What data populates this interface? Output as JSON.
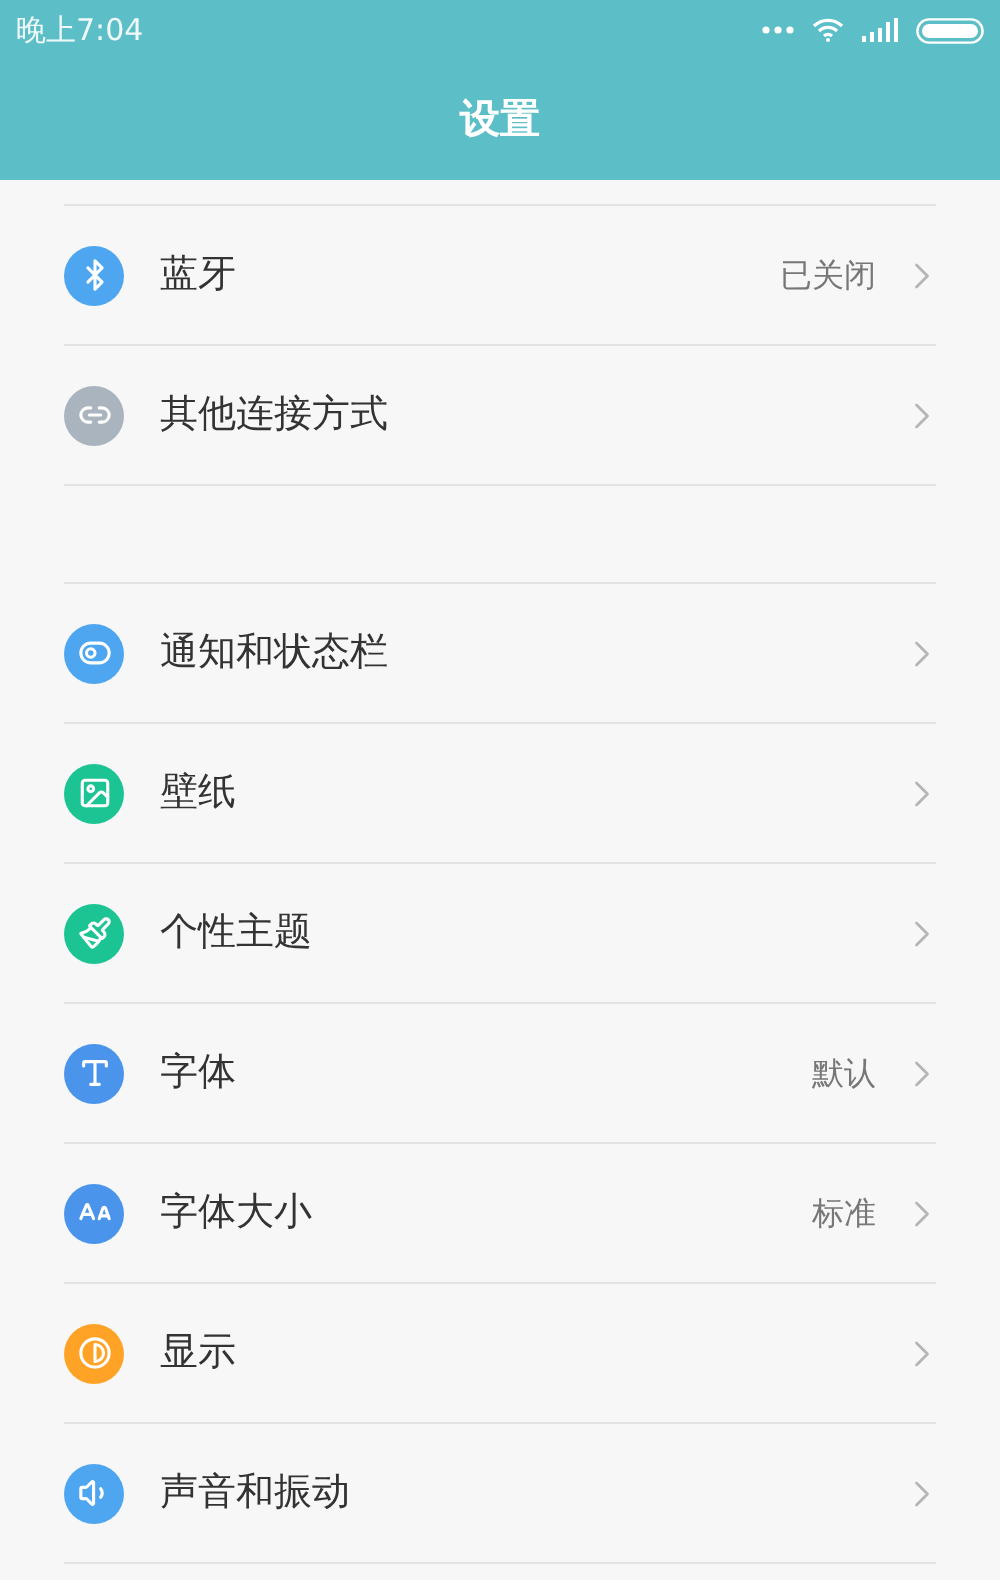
{
  "status_bar": {
    "time": "晚上7:04"
  },
  "header": {
    "title": "设置"
  },
  "sections": [
    {
      "items": [
        {
          "label": "蓝牙",
          "value": "已关闭",
          "color": "#4fa6f0"
        },
        {
          "label": "其他连接方式",
          "color": "#aab4be"
        }
      ]
    },
    {
      "items": [
        {
          "label": "通知和状态栏",
          "color": "#4fa6f0"
        },
        {
          "label": "壁纸",
          "color": "#1cc393"
        },
        {
          "label": "个性主题",
          "color": "#1cc393"
        },
        {
          "label": "字体",
          "value": "默认",
          "color": "#4a94ec"
        },
        {
          "label": "字体大小",
          "value": "标准",
          "color": "#4a94ec"
        },
        {
          "label": "显示",
          "color": "#ffa326"
        },
        {
          "label": "声音和振动",
          "color": "#4fa6f0"
        }
      ]
    }
  ]
}
